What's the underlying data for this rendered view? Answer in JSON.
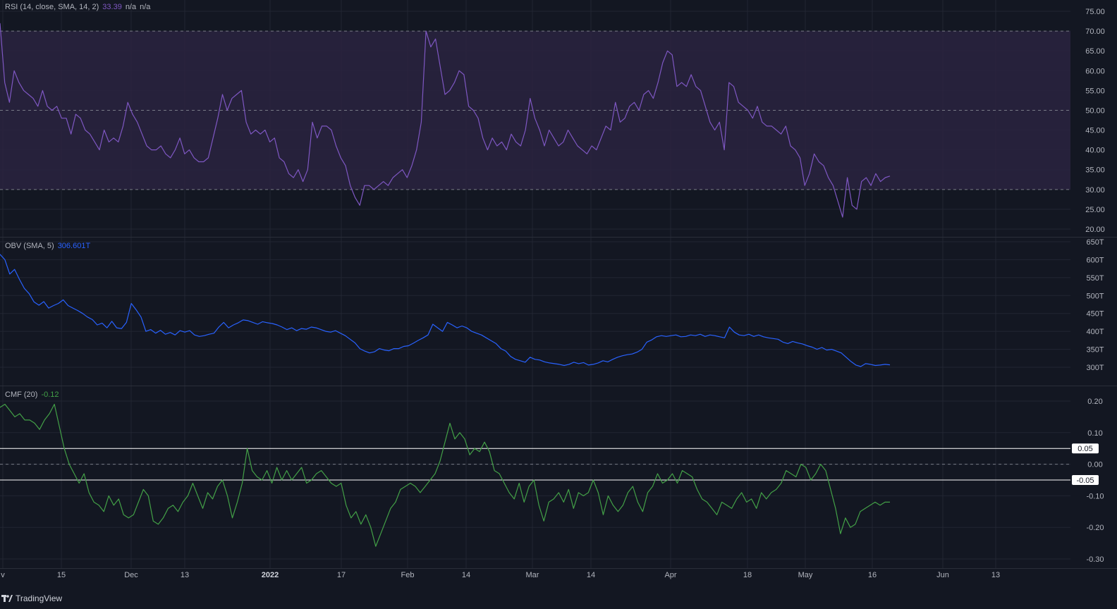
{
  "colors": {
    "background": "#131722",
    "grid": "#222632",
    "separator": "#2a2e39",
    "axis_text": "#b2b5be",
    "rsi_line": "#7e57c2",
    "rsi_band": "#2a2340",
    "obv_line": "#2962ff",
    "cmf_line": "#43a047",
    "level_line": "#ffffff"
  },
  "legends": {
    "rsi": {
      "label": "RSI (14, close, SMA, 14, 2)",
      "value": "33.39",
      "extra1": "n/a",
      "extra2": "n/a"
    },
    "obv": {
      "label": "OBV (SMA, 5)",
      "value": "306.601T"
    },
    "cmf": {
      "label": "CMF (20)",
      "value": "-0.12"
    }
  },
  "footer": {
    "brand": "TradingView"
  },
  "chart_data": [
    {
      "type": "line",
      "name": "RSI",
      "yticks": [
        "75.00",
        "70.00",
        "65.00",
        "60.00",
        "55.00",
        "50.00",
        "45.00",
        "40.00",
        "35.00",
        "30.00",
        "25.00",
        "20.00"
      ],
      "ylim": [
        20,
        75
      ],
      "levels": [
        70,
        50,
        30
      ],
      "band": [
        30,
        70
      ],
      "series": [
        {
          "name": "RSI",
          "values": [
            72,
            57,
            52,
            60,
            57,
            55,
            54,
            53,
            51,
            55,
            51,
            50,
            51,
            48,
            48,
            44,
            49,
            48,
            45,
            44,
            42,
            40,
            45,
            42,
            43,
            42,
            46,
            52,
            49,
            47,
            44,
            41,
            40,
            40,
            41,
            39,
            38,
            40,
            43,
            39,
            40,
            38,
            37,
            37,
            38,
            43,
            48,
            54,
            50,
            53,
            54,
            55,
            47,
            44,
            45,
            44,
            45,
            42,
            43,
            38,
            37,
            34,
            33,
            35,
            32,
            35,
            47,
            43,
            46,
            46,
            45,
            41,
            38,
            36,
            31,
            28,
            26,
            31,
            31,
            30,
            31,
            32,
            31,
            33,
            34,
            35,
            33,
            36,
            40,
            47,
            70,
            66,
            68,
            61,
            54,
            55,
            57,
            60,
            59,
            51,
            50,
            48,
            43,
            40,
            43,
            41,
            42,
            40,
            44,
            42,
            41,
            45,
            53,
            48,
            45,
            41,
            45,
            43,
            41,
            42,
            45,
            43,
            41,
            40,
            39,
            41,
            40,
            43,
            46,
            45,
            52,
            47,
            48,
            51,
            52,
            50,
            54,
            55,
            53,
            57,
            62,
            65,
            64,
            56,
            57,
            56,
            59,
            56,
            55,
            51,
            47,
            45,
            47,
            40,
            57,
            56,
            52,
            51,
            50,
            48,
            51,
            47,
            46,
            46,
            45,
            44,
            46,
            41,
            40,
            38,
            31,
            34,
            39,
            37,
            36,
            33,
            31,
            27,
            23,
            33,
            26,
            25,
            32,
            33,
            31,
            34,
            32,
            33,
            33.39
          ]
        }
      ]
    },
    {
      "type": "line",
      "name": "OBV",
      "yticks": [
        "650T",
        "600T",
        "550T",
        "500T",
        "450T",
        "400T",
        "350T",
        "300T"
      ],
      "ylim": [
        300,
        650
      ],
      "series": [
        {
          "name": "OBV (SMA, 5)",
          "values": [
            615,
            600,
            560,
            573,
            545,
            520,
            505,
            482,
            473,
            483,
            465,
            472,
            478,
            488,
            472,
            465,
            458,
            450,
            440,
            433,
            418,
            423,
            410,
            428,
            410,
            408,
            425,
            478,
            460,
            440,
            400,
            405,
            395,
            403,
            392,
            397,
            390,
            402,
            398,
            402,
            390,
            386,
            388,
            392,
            395,
            412,
            425,
            410,
            418,
            424,
            432,
            430,
            425,
            420,
            427,
            424,
            422,
            418,
            412,
            405,
            410,
            402,
            408,
            406,
            412,
            410,
            405,
            400,
            398,
            402,
            395,
            388,
            378,
            368,
            352,
            345,
            340,
            343,
            352,
            348,
            346,
            352,
            352,
            358,
            360,
            367,
            375,
            382,
            390,
            420,
            410,
            400,
            425,
            418,
            410,
            415,
            410,
            400,
            395,
            390,
            382,
            374,
            366,
            352,
            345,
            330,
            322,
            318,
            314,
            328,
            322,
            320,
            315,
            312,
            310,
            308,
            305,
            308,
            314,
            310,
            313,
            306,
            308,
            312,
            318,
            315,
            322,
            328,
            332,
            335,
            337,
            342,
            350,
            370,
            376,
            385,
            388,
            386,
            388,
            390,
            385,
            386,
            390,
            388,
            392,
            386,
            390,
            388,
            385,
            382,
            412,
            398,
            390,
            388,
            392,
            386,
            390,
            385,
            382,
            380,
            378,
            370,
            366,
            372,
            368,
            365,
            360,
            356,
            350,
            355,
            348,
            350,
            345,
            340,
            328,
            316,
            306,
            302,
            310,
            308,
            305,
            306,
            308,
            306.6
          ]
        }
      ]
    },
    {
      "type": "line",
      "name": "CMF",
      "yticks": [
        "0.20",
        "0.10",
        "0.00",
        "-0.10",
        "-0.20",
        "-0.30"
      ],
      "ylim": [
        -0.32,
        0.22
      ],
      "levels": [
        0.05,
        0.0,
        -0.05
      ],
      "level_tags": [
        "0.05",
        "-0.05"
      ],
      "series": [
        {
          "name": "CMF (20)",
          "values": [
            0.18,
            0.19,
            0.17,
            0.15,
            0.16,
            0.14,
            0.14,
            0.13,
            0.11,
            0.14,
            0.16,
            0.19,
            0.12,
            0.05,
            0.0,
            -0.03,
            -0.06,
            -0.03,
            -0.09,
            -0.12,
            -0.13,
            -0.15,
            -0.1,
            -0.13,
            -0.11,
            -0.16,
            -0.17,
            -0.16,
            -0.12,
            -0.08,
            -0.1,
            -0.18,
            -0.19,
            -0.17,
            -0.14,
            -0.13,
            -0.15,
            -0.12,
            -0.1,
            -0.06,
            -0.1,
            -0.14,
            -0.09,
            -0.11,
            -0.07,
            -0.05,
            -0.1,
            -0.17,
            -0.12,
            -0.06,
            0.05,
            -0.02,
            -0.04,
            -0.05,
            -0.02,
            -0.06,
            -0.01,
            -0.05,
            -0.02,
            -0.05,
            -0.03,
            -0.01,
            -0.06,
            -0.05,
            -0.03,
            -0.02,
            -0.04,
            -0.06,
            -0.07,
            -0.06,
            -0.13,
            -0.17,
            -0.15,
            -0.19,
            -0.16,
            -0.2,
            -0.26,
            -0.22,
            -0.18,
            -0.14,
            -0.12,
            -0.08,
            -0.07,
            -0.06,
            -0.07,
            -0.09,
            -0.07,
            -0.05,
            -0.03,
            0.01,
            0.07,
            0.13,
            0.08,
            0.1,
            0.08,
            0.03,
            0.05,
            0.04,
            0.07,
            0.04,
            -0.02,
            -0.03,
            -0.06,
            -0.09,
            -0.11,
            -0.06,
            -0.12,
            -0.07,
            -0.05,
            -0.13,
            -0.18,
            -0.12,
            -0.11,
            -0.09,
            -0.12,
            -0.08,
            -0.14,
            -0.09,
            -0.1,
            -0.09,
            -0.05,
            -0.09,
            -0.16,
            -0.1,
            -0.13,
            -0.15,
            -0.13,
            -0.09,
            -0.07,
            -0.12,
            -0.15,
            -0.09,
            -0.07,
            -0.03,
            -0.06,
            -0.05,
            -0.03,
            -0.06,
            -0.02,
            -0.03,
            -0.04,
            -0.08,
            -0.11,
            -0.12,
            -0.14,
            -0.16,
            -0.12,
            -0.13,
            -0.14,
            -0.11,
            -0.09,
            -0.12,
            -0.11,
            -0.14,
            -0.09,
            -0.11,
            -0.09,
            -0.08,
            -0.06,
            -0.02,
            -0.03,
            -0.04,
            0.0,
            -0.01,
            -0.05,
            -0.03,
            0.0,
            -0.02,
            -0.08,
            -0.14,
            -0.22,
            -0.17,
            -0.2,
            -0.19,
            -0.15,
            -0.14,
            -0.13,
            -0.12,
            -0.13,
            -0.12,
            -0.12
          ]
        }
      ]
    }
  ],
  "x_axis": {
    "labels": [
      "v",
      "15",
      "Dec",
      "13",
      "2022",
      "17",
      "Feb",
      "14",
      "Mar",
      "14",
      "Apr",
      "18",
      "May",
      "16",
      "Jun",
      "13"
    ],
    "bold_labels": [
      "2022"
    ]
  }
}
